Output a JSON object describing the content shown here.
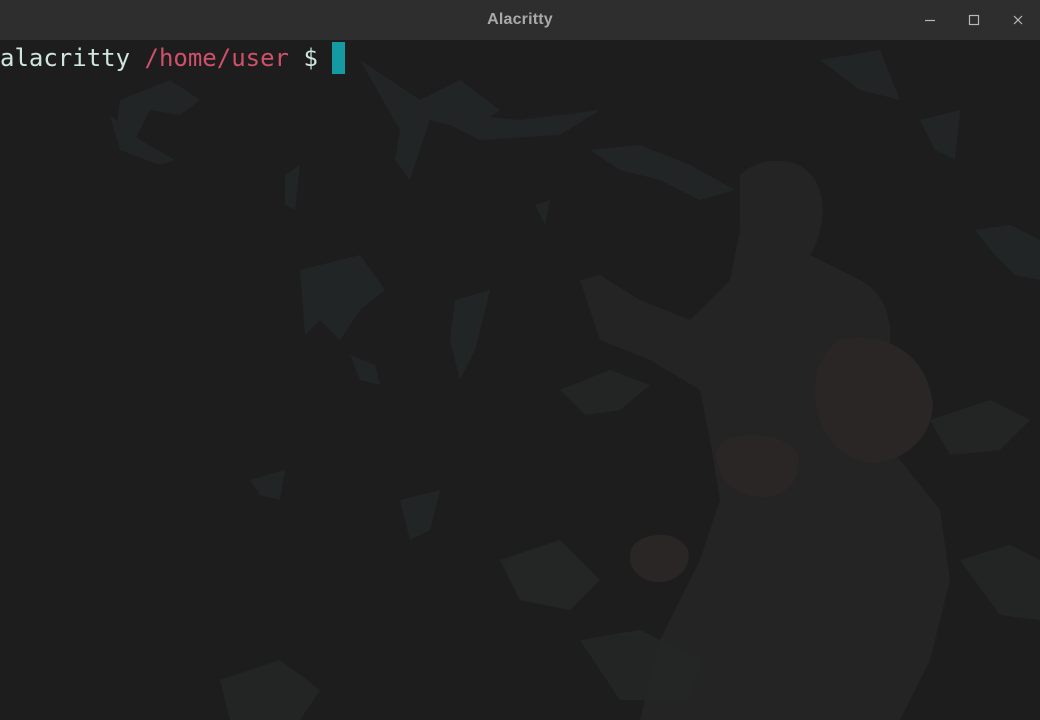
{
  "window": {
    "title": "Alacritty",
    "controls": {
      "minimize_icon": "minimize-icon",
      "maximize_icon": "maximize-icon",
      "close_icon": "close-icon"
    }
  },
  "terminal": {
    "prompt": {
      "host": "alacritty",
      "path": "/home/user",
      "symbol": "$"
    },
    "colors": {
      "background": "#1d1d1d",
      "host": "#cfe6df",
      "path": "#d0506b",
      "cursor": "#149aa3"
    }
  }
}
